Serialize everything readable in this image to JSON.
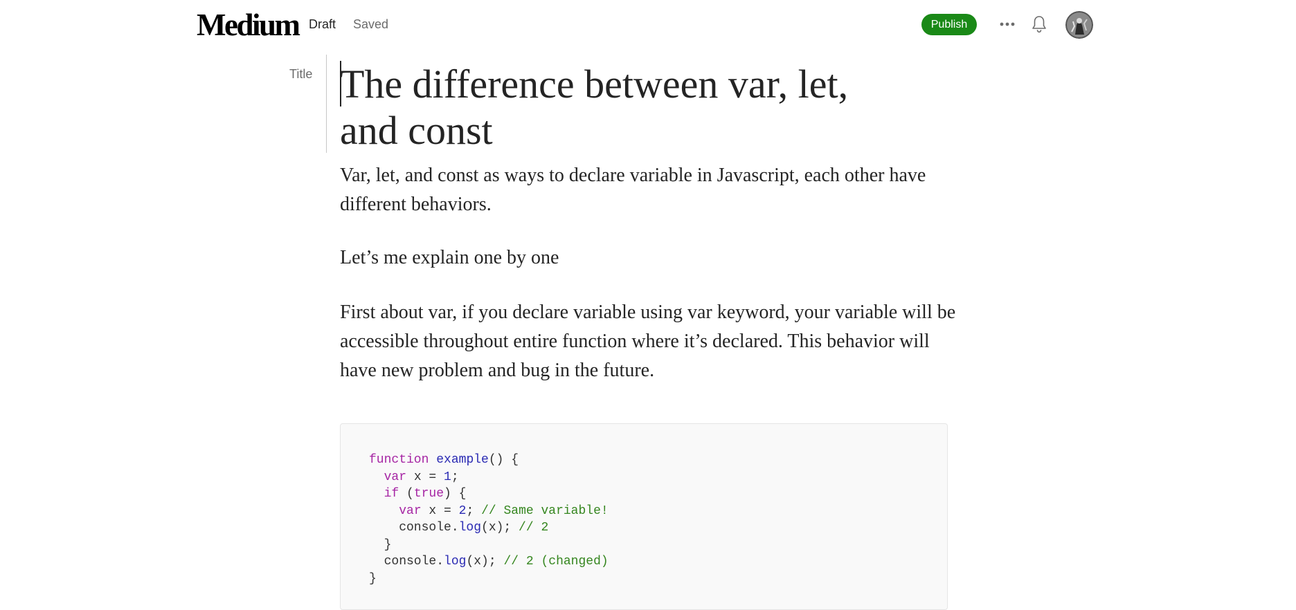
{
  "header": {
    "logo": "Medium",
    "status_draft": "Draft",
    "status_saved": "Saved",
    "publish_label": "Publish",
    "more_icon": "more-horizontal-icon",
    "bell_icon": "bell-icon",
    "avatar": "user-avatar"
  },
  "editor": {
    "title_label": "Title",
    "title": "The difference between var, let, and const",
    "paragraphs": [
      "Var, let, and const as ways to declare variable in Javascript, each other have different behaviors.",
      "Let’s me explain one by one",
      "First about var, if you declare variable using var keyword, your variable will be accessible throughout entire function where it’s declared. This behavior will have new problem and bug in the future."
    ],
    "code": {
      "lines": [
        [
          [
            "kw",
            "function"
          ],
          [
            "p",
            " "
          ],
          [
            "fn",
            "example"
          ],
          [
            "p",
            "() {"
          ]
        ],
        [
          [
            "p",
            "  "
          ],
          [
            "kw",
            "var"
          ],
          [
            "p",
            " x = "
          ],
          [
            "num",
            "1"
          ],
          [
            "p",
            ";"
          ]
        ],
        [
          [
            "p",
            "  "
          ],
          [
            "kw",
            "if"
          ],
          [
            "p",
            " ("
          ],
          [
            "kw",
            "true"
          ],
          [
            "p",
            ") {"
          ]
        ],
        [
          [
            "p",
            "    "
          ],
          [
            "kw",
            "var"
          ],
          [
            "p",
            " x = "
          ],
          [
            "num",
            "2"
          ],
          [
            "p",
            "; "
          ],
          [
            "cm",
            "// Same variable!"
          ]
        ],
        [
          [
            "p",
            "    console."
          ],
          [
            "fn",
            "log"
          ],
          [
            "p",
            "(x); "
          ],
          [
            "cm",
            "// 2"
          ]
        ],
        [
          [
            "p",
            "  }"
          ]
        ],
        [
          [
            "p",
            "  console."
          ],
          [
            "fn",
            "log"
          ],
          [
            "p",
            "(x); "
          ],
          [
            "cm",
            "// 2 (changed)"
          ]
        ],
        [
          [
            "p",
            "}"
          ]
        ]
      ]
    }
  },
  "colors": {
    "publish_bg": "#1a8917",
    "keyword": "#a626a4",
    "function": "#2a2ab3",
    "comment": "#35861f"
  }
}
